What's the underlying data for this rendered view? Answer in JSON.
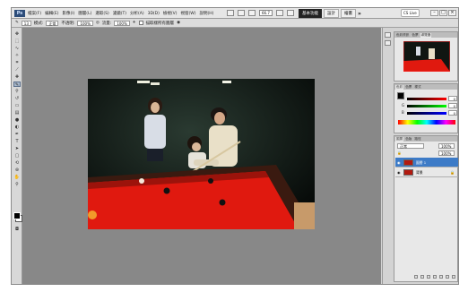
{
  "app": {
    "logo": "Ps",
    "menu": [
      "檔案(F)",
      "編輯(E)",
      "影像(I)",
      "圖層(L)",
      "選取(S)",
      "濾鏡(T)",
      "分析(A)",
      "3D(D)",
      "檢視(V)",
      "視窗(W)",
      "說明(H)"
    ],
    "zoom": "66.7",
    "workspace_tabs": [
      {
        "label": "基本功能",
        "active": true
      },
      {
        "label": "設計",
        "active": false
      },
      {
        "label": "繪畫",
        "active": false
      }
    ],
    "more": "»",
    "cs_live": "CS Live"
  },
  "options": {
    "brush_size": "13",
    "mode_label": "模式:",
    "mode_value": "正常",
    "opacity_label": "不透明:",
    "opacity_value": "100%",
    "flow_label": "流量:",
    "flow_value": "100%",
    "sample_all_layers": "描取樣所有圖層"
  },
  "panels": {
    "navigator_tabs": [
      "色彩資訊",
      "色票",
      "導覽器"
    ],
    "color_tabs": [
      "色彩",
      "色票",
      "樣式"
    ],
    "color_values": {
      "r": "0",
      "g": "0",
      "b": "0"
    },
    "layer_tabs": [
      "圖層",
      "色版",
      "路徑"
    ],
    "blend_mode": "正常",
    "opacity": "100%",
    "fill": "100%",
    "layers": [
      {
        "name": "圖層 1",
        "selected": true
      },
      {
        "name": "背景",
        "selected": false
      }
    ]
  },
  "colors": {
    "accent": "#3d7bc7",
    "canvas_bg": "#888888",
    "table_felt": "#e0190f"
  }
}
